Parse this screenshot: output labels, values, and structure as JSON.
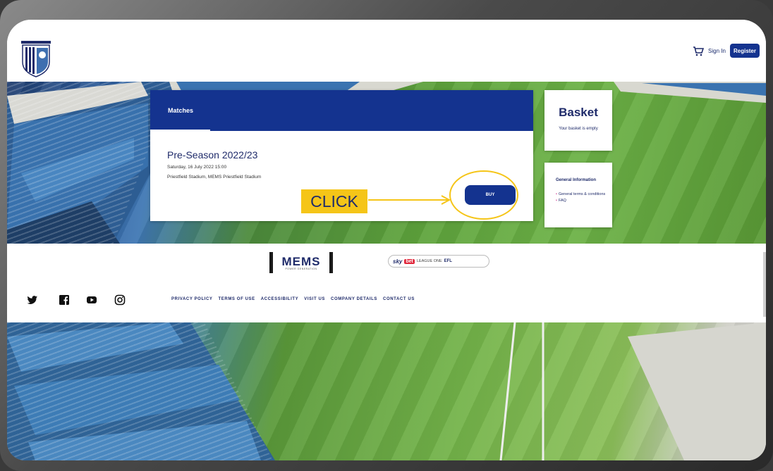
{
  "header": {
    "signin_label": "Sign In",
    "register_label": "Register",
    "cart_icon": "cart-icon",
    "logo_icon": "club-crest-logo"
  },
  "matches": {
    "heading": "Matches",
    "match_title": "Pre-Season 2022/23",
    "match_date": "Saturday, 16 July 2022 15:00",
    "match_venue": "Priestfield Stadium, MEMS Priestfield Stadium",
    "buy_label": "BUY"
  },
  "annotation": {
    "click_label": "CLICK",
    "highlight_color": "#f5c518"
  },
  "basket": {
    "title": "Basket",
    "empty_text": "Your basket is empty"
  },
  "info": {
    "title": "General Information",
    "links": [
      "General terms & conditions",
      "FAQ"
    ]
  },
  "footer": {
    "mems_logo": "MEMS",
    "mems_sub": "POWER GENERATION",
    "sponsor_sky": "sky",
    "sponsor_bet": "bet",
    "sponsor_league": "LEAGUE ONE",
    "sponsor_efl": "EFL",
    "social_icons": [
      "twitter-icon",
      "facebook-icon",
      "youtube-icon",
      "instagram-icon"
    ],
    "nav": [
      "PRIVACY POLICY",
      "TERMS OF USE",
      "ACCESSIBILITY",
      "VISIT US",
      "COMPANY DETAILS",
      "CONTACT US"
    ]
  },
  "colors": {
    "brand_blue": "#14338f",
    "text_navy": "#1f2b6a"
  }
}
